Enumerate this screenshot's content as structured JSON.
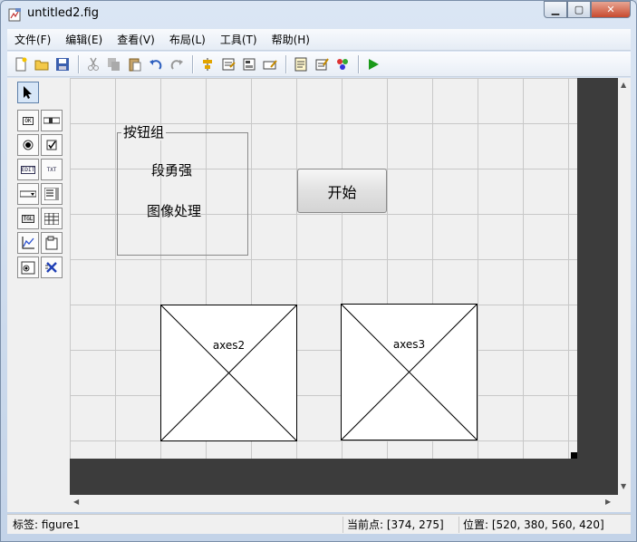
{
  "window": {
    "title": "untitled2.fig",
    "minimize_icon": "minimize-icon",
    "maximize_icon": "maximize-icon",
    "close_icon": "close-icon"
  },
  "menu": [
    "文件(F)",
    "编辑(E)",
    "查看(V)",
    "布局(L)",
    "工具(T)",
    "帮助(H)"
  ],
  "toolbar": {
    "icons": [
      "new-file-icon",
      "open-folder-icon",
      "save-icon",
      "cut-icon",
      "copy-icon",
      "paste-icon",
      "undo-icon",
      "redo-icon",
      "align-icon",
      "menu-editor-icon",
      "tab-order-icon",
      "toolbar-editor-icon",
      "editor-icon",
      "property-inspector-icon",
      "object-browser-icon",
      "run-icon"
    ]
  },
  "palette": {
    "tools": [
      "select-arrow",
      "push-button",
      "slider",
      "radio-button",
      "check-box",
      "edit-text",
      "static-text",
      "popup-menu",
      "list-box",
      "toggle-button",
      "table",
      "axes",
      "panel",
      "button-group",
      "activex-control"
    ],
    "labels": {
      "push": "OK",
      "edit": "EDIT",
      "static": "TXT",
      "toggle": "TGL"
    }
  },
  "canvas": {
    "button_group": {
      "title": "按钮组",
      "line1": "段勇强",
      "line2": "图像处理"
    },
    "start_button": "开始",
    "axes": [
      "axes2",
      "axes3"
    ]
  },
  "status": {
    "tag": "标签: figure1",
    "current_point": "当前点:  [374, 275]",
    "position": "位置: [520, 380, 560, 420]"
  },
  "colors": {
    "run": "#1a9a1a",
    "canvas_bg": "#3c3c3c",
    "grid": "#c8c8c8"
  }
}
